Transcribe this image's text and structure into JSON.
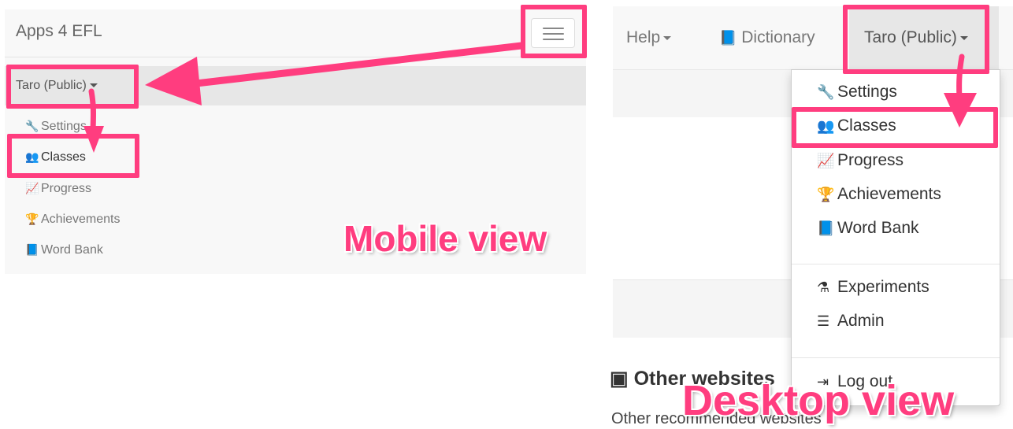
{
  "mobile": {
    "brand": "Apps 4 EFL",
    "user_menu_label": "Taro (Public)",
    "items": [
      {
        "icon": "wrench-icon",
        "glyph": "🔧",
        "label": "Settings"
      },
      {
        "icon": "users-icon",
        "glyph": "👥",
        "label": "Classes"
      },
      {
        "icon": "line-chart-icon",
        "glyph": "📈",
        "label": "Progress"
      },
      {
        "icon": "trophy-icon",
        "glyph": "🏆",
        "label": "Achievements"
      },
      {
        "icon": "book-icon",
        "glyph": "📘",
        "label": "Word Bank"
      }
    ],
    "caption": "Mobile view"
  },
  "desktop": {
    "nav": {
      "help": "Help",
      "dictionary": "Dictionary",
      "user_menu_label": "Taro (Public)"
    },
    "menu_items": [
      {
        "icon": "wrench-icon",
        "glyph": "🔧",
        "label": "Settings"
      },
      {
        "icon": "users-icon",
        "glyph": "👥",
        "label": "Classes"
      },
      {
        "icon": "line-chart-icon",
        "glyph": "📈",
        "label": "Progress"
      },
      {
        "icon": "trophy-icon",
        "glyph": "🏆",
        "label": "Achievements"
      },
      {
        "icon": "book-icon",
        "glyph": "📘",
        "label": "Word Bank"
      },
      {
        "icon": "flask-icon",
        "glyph": "⚗",
        "label": "Experiments"
      },
      {
        "icon": "server-icon",
        "glyph": "☰",
        "label": "Admin"
      },
      {
        "icon": "sign-out-icon",
        "glyph": "⇥",
        "label": "Log out"
      }
    ],
    "background_heading": "Other websites",
    "background_text": "Other recommended websites",
    "caption": "Desktop view"
  },
  "colors": {
    "accent": "#ff3d7f",
    "navbar": "#f8f8f8",
    "active": "#e7e7e7"
  }
}
